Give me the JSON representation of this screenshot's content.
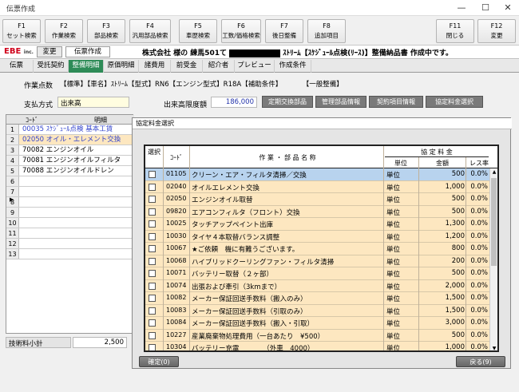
{
  "window": {
    "title": "伝票作成",
    "minimize": "—",
    "maximize": "☐",
    "close": "✕"
  },
  "fkeys": [
    {
      "key": "F1",
      "label": "セット検索"
    },
    {
      "key": "F2",
      "label": "作業検索"
    },
    {
      "key": "F3",
      "label": "部品検索"
    },
    {
      "key": "F4",
      "label": "汎用部品検索"
    },
    {
      "key": "F5",
      "label": "車歴検索"
    },
    {
      "key": "F6",
      "label": "工数/価格検索"
    },
    {
      "key": "F7",
      "label": "後日整備"
    },
    {
      "key": "F8",
      "label": "追加項目"
    },
    {
      "key": "F11",
      "label": "閉じる"
    },
    {
      "key": "F12",
      "label": "変更"
    }
  ],
  "header": {
    "logo": "EBE",
    "logo_sub": "inc.",
    "change_button": "変更",
    "mode": "伝票作成",
    "info_prefix": "株式会社 様の 練馬501て",
    "info_suffix": "ｽﾄﾘｰﾑ【ｽｹｼﾞｭｰﾙ点検(ﾘｰｽ)】整備納品書 作成中です。"
  },
  "tabs": [
    "伝票",
    "受託契約",
    "整備明細",
    "原価明細",
    "諸費用",
    "前受金",
    "紹介者",
    "プレビュー",
    "作成条件"
  ],
  "form": {
    "work_points_label": "作業点数",
    "work_points_value": "【標準】【車名】ｽﾄﾘｰﾑ【型式】RN6【エンジン型式】R18A【補助条件】",
    "work_points_tag": "【一般整備】",
    "payment_label": "支払方式",
    "payment_value": "出来高",
    "limit_label": "出来高限度額",
    "limit_value": "186,000",
    "buttons": [
      "定期交換部品",
      "管理部品情報",
      "契約項目情報",
      "協定料金選択"
    ]
  },
  "grid": {
    "header_code": "ｺｰﾄﾞ",
    "header_desc": "明細",
    "rows": [
      {
        "n": "1",
        "text": "00035 ｽｹｼﾞｭｰﾙ点検  基本工賃"
      },
      {
        "n": "2",
        "text": "02050 オイル・エレメント交換"
      },
      {
        "n": "3",
        "text": "70082 エンジンオイル"
      },
      {
        "n": "4",
        "text": "70081 エンジンオイルフィルタ"
      },
      {
        "n": "5",
        "text": "70088 エンジンオイルドレン"
      },
      {
        "n": "6",
        "text": ""
      },
      {
        "n": "7",
        "text": ""
      },
      {
        "n": "8",
        "text": ""
      },
      {
        "n": "9",
        "text": ""
      },
      {
        "n": "10",
        "text": ""
      },
      {
        "n": "11",
        "text": ""
      },
      {
        "n": "12",
        "text": ""
      },
      {
        "n": "13",
        "text": ""
      }
    ],
    "current_row_marker": "▶",
    "subtotal_label": "技術料小計",
    "subtotal_value": "2,500"
  },
  "modal": {
    "title": "協定料金選択",
    "h_select": "選択",
    "h_code": "ｺｰﾄﾞ",
    "h_name": "作 業 ・ 部 品 名 称",
    "h_fee": "協 定 料 金",
    "h_unit": "単位",
    "h_amount": "金額",
    "h_rate": "レス率",
    "rows": [
      {
        "code": "01105",
        "name": "クリーン・エア・フィルタ清掃／交換",
        "unit": "単位",
        "amount": "500",
        "rate": "0.0%"
      },
      {
        "code": "02040",
        "name": "オイルエレメント交換",
        "unit": "単位",
        "amount": "1,000",
        "rate": "0.0%"
      },
      {
        "code": "02050",
        "name": "エンジンオイル取替",
        "unit": "単位",
        "amount": "500",
        "rate": "0.0%"
      },
      {
        "code": "09820",
        "name": "エアコンフィルタ（フロント）交換",
        "unit": "単位",
        "amount": "500",
        "rate": "0.0%"
      },
      {
        "code": "10025",
        "name": "タッチアップペイント出庫",
        "unit": "単位",
        "amount": "1,300",
        "rate": "0.0%"
      },
      {
        "code": "10030",
        "name": "タイヤ４本取替バランス調整",
        "unit": "単位",
        "amount": "1,200",
        "rate": "0.0%"
      },
      {
        "code": "10067",
        "name": "★ご依頼　機に有難うございます。",
        "unit": "単位",
        "amount": "800",
        "rate": "0.0%"
      },
      {
        "code": "10068",
        "name": "ハイブリッドクーリングファン・フィルタ清掃",
        "unit": "単位",
        "amount": "200",
        "rate": "0.0%"
      },
      {
        "code": "10071",
        "name": "バッテリー取替（２ヶ部）",
        "unit": "単位",
        "amount": "500",
        "rate": "0.0%"
      },
      {
        "code": "10074",
        "name": "出張および牽引（3kmまで）",
        "unit": "単位",
        "amount": "2,000",
        "rate": "0.0%"
      },
      {
        "code": "10082",
        "name": "メーカー保証回送手数料（搬入のみ）",
        "unit": "単位",
        "amount": "1,500",
        "rate": "0.0%"
      },
      {
        "code": "10083",
        "name": "メーカー保証回送手数料（引取のみ）",
        "unit": "単位",
        "amount": "1,500",
        "rate": "0.0%"
      },
      {
        "code": "10084",
        "name": "メーカー保証回送手数料（搬入・引取）",
        "unit": "単位",
        "amount": "3,000",
        "rate": "0.0%"
      },
      {
        "code": "10227",
        "name": "産業廃棄物処理費用（一台あたり　¥500）",
        "unit": "単位",
        "amount": "500",
        "rate": "0.0%"
      },
      {
        "code": "10304",
        "name": "バッテリー充電　　　　（外車　4000）",
        "unit": "単位",
        "amount": "1,000",
        "rate": "0.0%"
      }
    ],
    "confirm_button": "確定(0)",
    "back_button": "戻る(9)"
  }
}
